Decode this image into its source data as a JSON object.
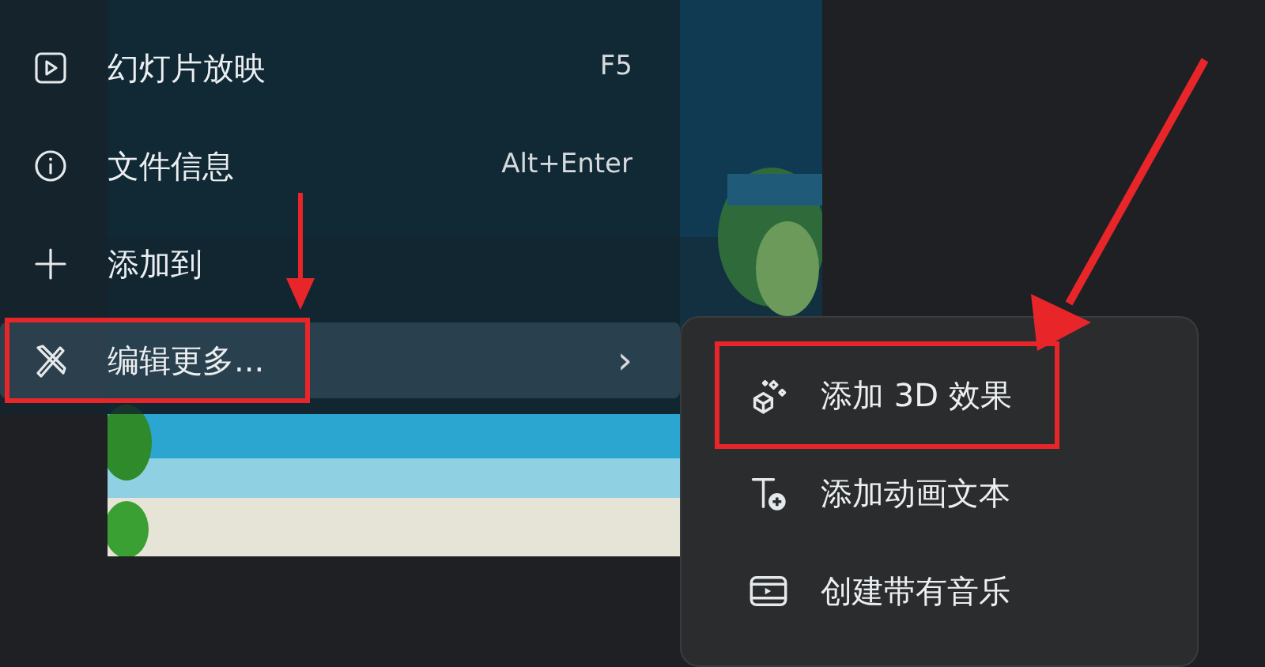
{
  "context_menu": {
    "items": [
      {
        "kind": "slideshow",
        "label": "幻灯片放映",
        "shortcut": "F5",
        "selected": false,
        "annotated": false
      },
      {
        "kind": "info",
        "label": "文件信息",
        "shortcut": "Alt+Enter",
        "selected": false,
        "annotated": false
      },
      {
        "kind": "add",
        "label": "添加到",
        "selected": false,
        "annotated": false
      },
      {
        "kind": "edit",
        "label": "编辑更多...",
        "submenu": "›",
        "selected": true,
        "annotated": true
      }
    ]
  },
  "submenu": {
    "items": [
      {
        "kind": "effect3d",
        "label": "添加 3D 效果",
        "annotated": true
      },
      {
        "kind": "text",
        "label": "添加动画文本",
        "annotated": false
      },
      {
        "kind": "video",
        "label": "创建带有音乐",
        "annotated": false
      }
    ]
  }
}
